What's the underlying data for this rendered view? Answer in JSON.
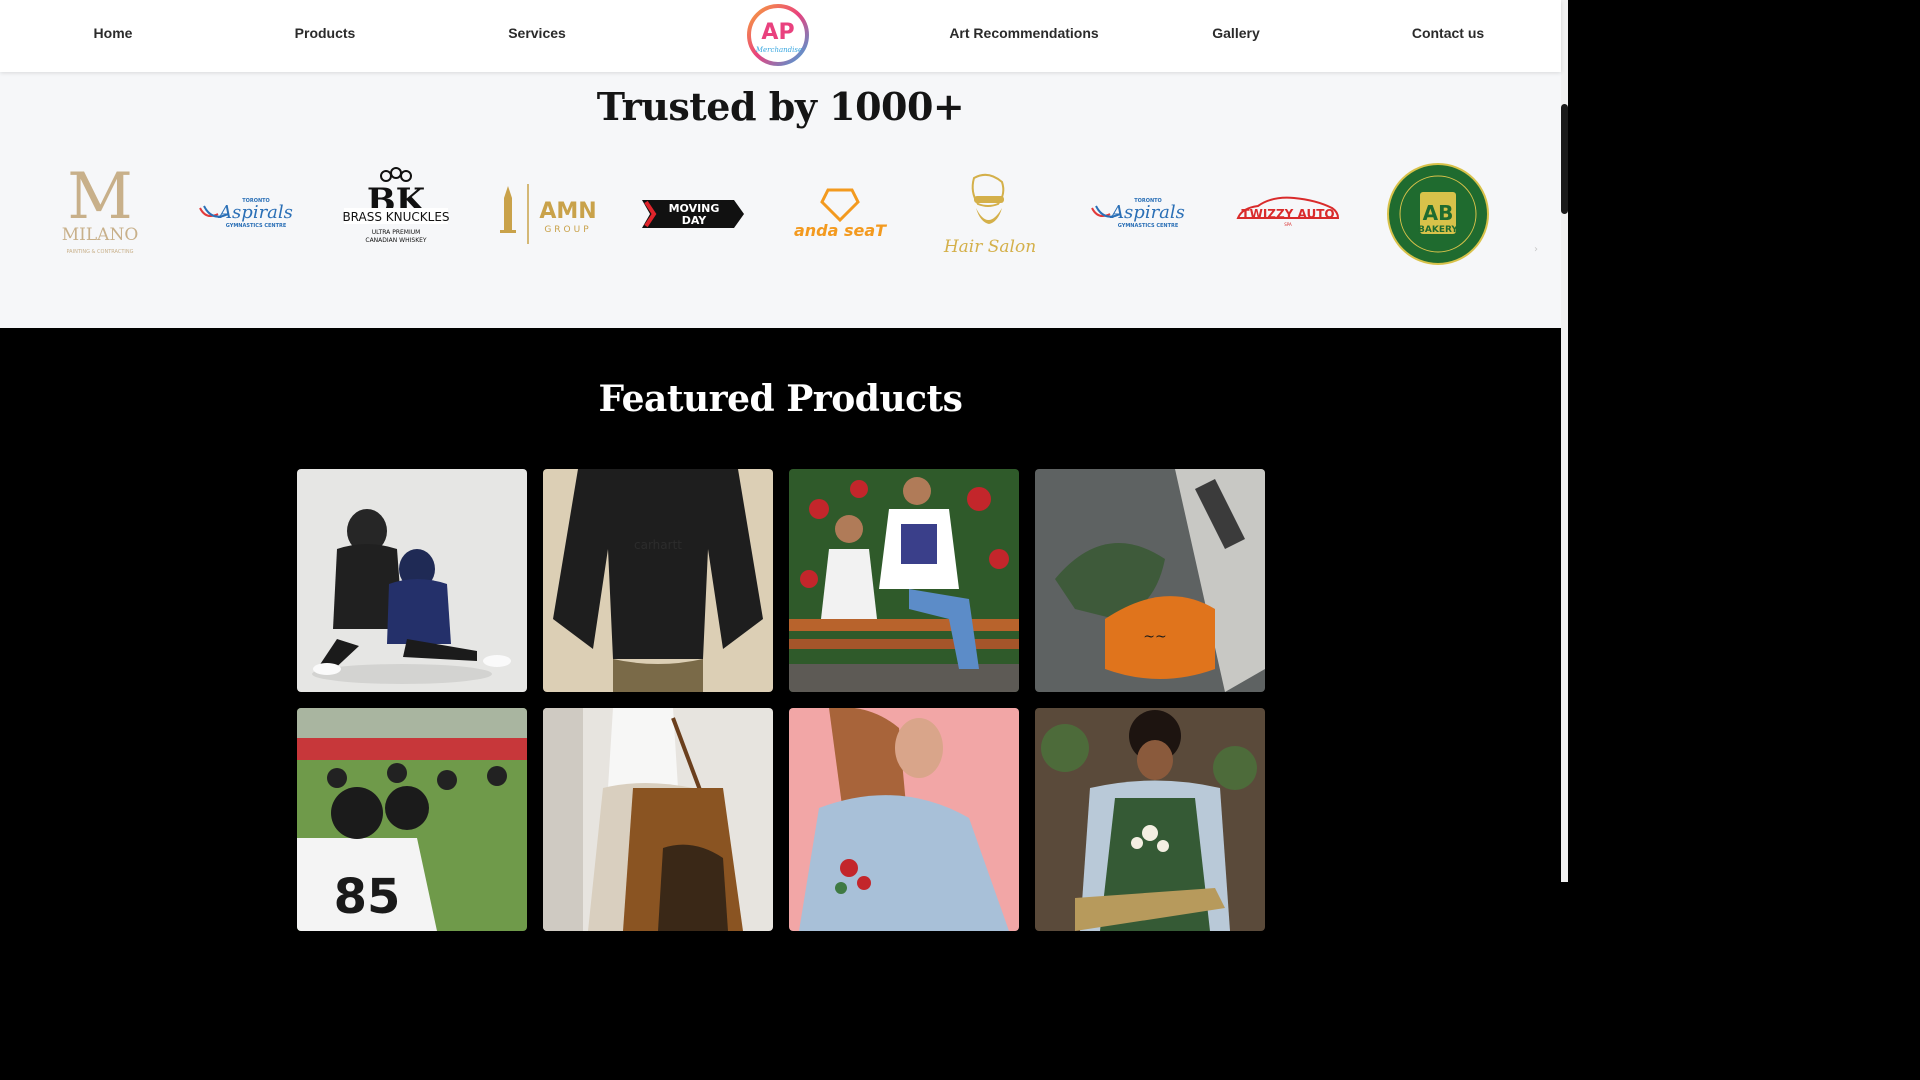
{
  "nav": {
    "items": [
      "Home",
      "Products",
      "Services",
      "Art Recommendations",
      "Gallery",
      "Contact us"
    ],
    "logo": {
      "initials": "AP",
      "script": "Merchandise"
    }
  },
  "trusted": {
    "title": "Trusted by 1000+",
    "logos": [
      {
        "name": "milano-logo",
        "lines": [
          "M",
          "MILANO",
          "PAINTING & CONTRACTING"
        ]
      },
      {
        "name": "toronto-aspirals-logo",
        "lines": [
          "TORONTO",
          "Aspirals",
          "GYMNASTICS CENTRE"
        ]
      },
      {
        "name": "brass-knuckles-logo",
        "lines": [
          "BK",
          "BRASS KNUCKLES",
          "ULTRA PREMIUM",
          "CANADIAN WHISKEY"
        ]
      },
      {
        "name": "amn-group-logo",
        "lines": [
          "AMN",
          "GROUP"
        ]
      },
      {
        "name": "moving-day-logo",
        "lines": [
          "MOVING",
          "DAY"
        ]
      },
      {
        "name": "anda-seat-logo",
        "lines": [
          "anda seaT"
        ]
      },
      {
        "name": "hair-salon-logo",
        "lines": [
          "Hair Salon"
        ]
      },
      {
        "name": "toronto-aspirals-logo-2",
        "lines": [
          "TORONTO",
          "Aspirals",
          "GYMNASTICS CENTRE"
        ]
      },
      {
        "name": "twizzy-auto-logo",
        "lines": [
          "TWIZZY AUTO",
          "SPA"
        ]
      },
      {
        "name": "ab-bakery-logo",
        "lines": [
          "AB",
          "BAKERY"
        ]
      }
    ],
    "arrow": "›"
  },
  "featured": {
    "title": "Featured Products",
    "products": [
      {
        "name": "hoodies-couple",
        "scene": "hoodies"
      },
      {
        "name": "black-crewneck-sweatshirt",
        "scene": "sweatshirt",
        "print": "carhartt"
      },
      {
        "name": "tees-on-bench",
        "scene": "bench"
      },
      {
        "name": "embroidered-caps",
        "scene": "caps"
      },
      {
        "name": "football-jerseys",
        "scene": "football",
        "print": "85"
      },
      {
        "name": "leather-bag",
        "scene": "bag"
      },
      {
        "name": "embroidered-denim-jacket",
        "scene": "denim"
      },
      {
        "name": "embroidered-apron",
        "scene": "apron"
      }
    ]
  },
  "colors": {
    "nav_text": "#2b2b2b",
    "trusted_bg": "#f6f7f9",
    "featured_bg": "#000000",
    "logo_pink": "#e9417e",
    "logo_blue": "#3aa7e0",
    "gold": "#c9a24a"
  }
}
